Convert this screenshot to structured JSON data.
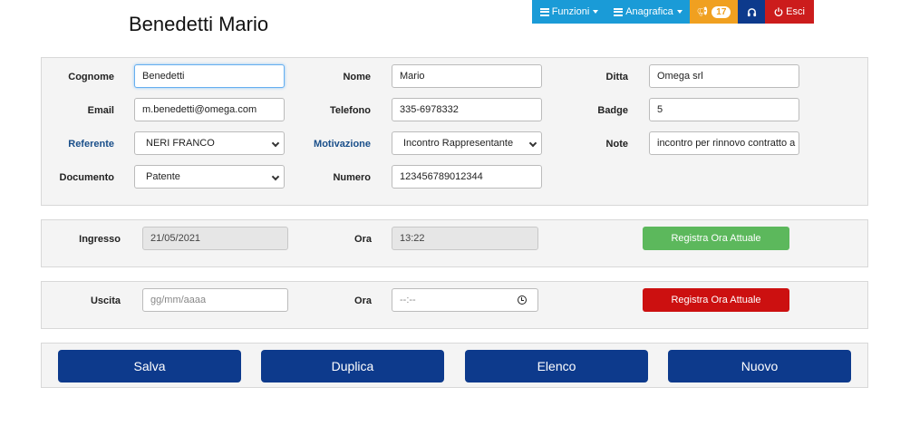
{
  "header": {
    "title": "Benedetti Mario"
  },
  "navbar": {
    "funzioni_label": "Funzioni",
    "anagrafica_label": "Anagrafica",
    "notifications_count": "17",
    "esci_label": "Esci",
    "colors": {
      "light_blue": "#1a9bd7",
      "orange": "#f0a020",
      "dark_blue": "#0d3a8c",
      "red": "#cc1c1c"
    }
  },
  "form": {
    "cognome": {
      "label": "Cognome",
      "value": "Benedetti"
    },
    "nome": {
      "label": "Nome",
      "value": "Mario"
    },
    "ditta": {
      "label": "Ditta",
      "value": "Omega srl"
    },
    "email": {
      "label": "Email",
      "value": "m.benedetti@omega.com"
    },
    "telefono": {
      "label": "Telefono",
      "value": "335-6978332"
    },
    "badge": {
      "label": "Badge",
      "value": "5"
    },
    "referente": {
      "label": "Referente",
      "value": "NERI FRANCO"
    },
    "motivazione": {
      "label": "Motivazione",
      "value": "Incontro Rappresentante"
    },
    "note": {
      "label": "Note",
      "value": "incontro per rinnovo contratto a"
    },
    "documento": {
      "label": "Documento",
      "value": "Patente"
    },
    "numero": {
      "label": "Numero",
      "value": "123456789012344"
    }
  },
  "ingresso": {
    "label": "Ingresso",
    "date": "21/05/2021",
    "ora_label": "Ora",
    "time": "13:22",
    "button_label": "Registra Ora Attuale"
  },
  "uscita": {
    "label": "Uscita",
    "date_placeholder": "gg/mm/aaaa",
    "ora_label": "Ora",
    "time_placeholder": "--:--",
    "button_label": "Registra Ora Attuale"
  },
  "actions": {
    "salva": "Salva",
    "duplica": "Duplica",
    "elenco": "Elenco",
    "nuovo": "Nuovo"
  }
}
